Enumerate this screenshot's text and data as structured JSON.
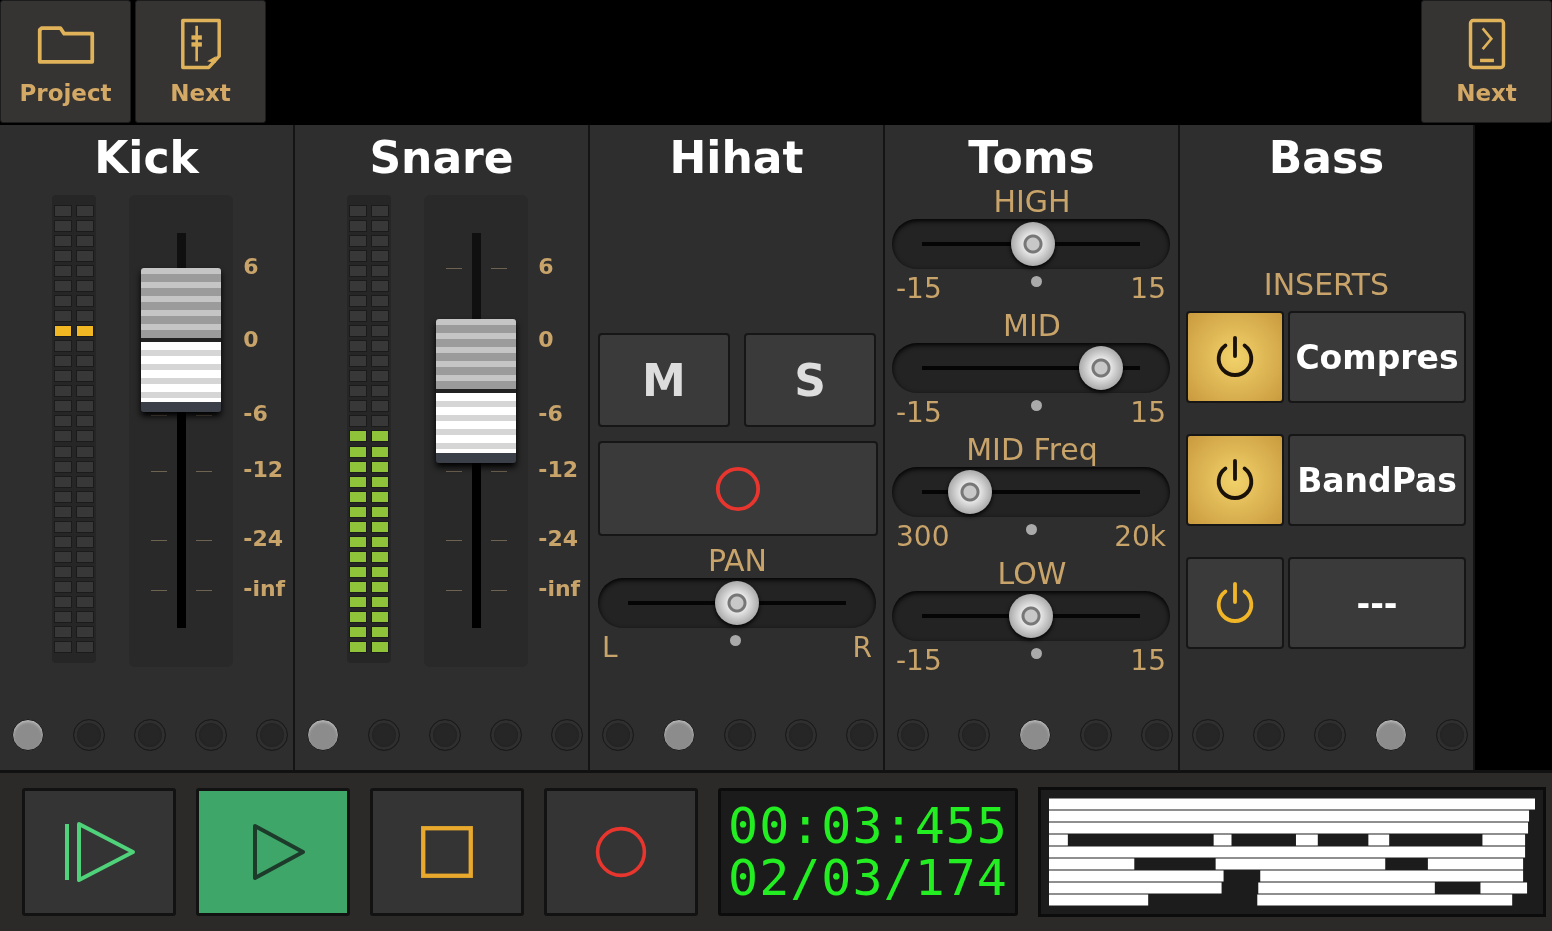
{
  "toolbar": {
    "left": [
      {
        "label": "Project",
        "kind": "folder"
      },
      {
        "label": "Next",
        "kind": "document"
      }
    ],
    "right": [
      {
        "label": "Next",
        "kind": "tablet"
      }
    ]
  },
  "channels": [
    {
      "name": "Kick",
      "kind": "fader",
      "meter": {
        "level": 0
      },
      "peak": {
        "level": 0.7
      },
      "fader": {
        "level": 0.73
      },
      "scale": [
        "6",
        "0",
        "-6",
        "-12",
        "-24",
        "-inf"
      ],
      "dots": [
        {
          "selected": true
        },
        {
          "selected": false
        },
        {
          "selected": false
        },
        {
          "selected": false
        },
        {
          "selected": false
        }
      ]
    },
    {
      "name": "Snare",
      "kind": "fader",
      "meter": {
        "level": 0.5
      },
      "fader": {
        "level": 0.6
      },
      "scale": [
        "6",
        "0",
        "-6",
        "-12",
        "-24",
        "-inf"
      ],
      "dots": [
        {
          "selected": true
        },
        {
          "selected": false
        },
        {
          "selected": false
        },
        {
          "selected": false
        },
        {
          "selected": false
        }
      ]
    },
    {
      "name": "Hihat",
      "kind": "controls",
      "mute": {
        "label": "M",
        "on": false
      },
      "solo": {
        "label": "S",
        "on": false
      },
      "record": {
        "armed": false
      },
      "pan": {
        "label": "PAN",
        "level": 0.5,
        "min": "L",
        "max": "R"
      },
      "dots": [
        {
          "selected": false
        },
        {
          "selected": true
        },
        {
          "selected": false
        },
        {
          "selected": false
        },
        {
          "selected": false
        }
      ]
    },
    {
      "name": "Toms",
      "kind": "eq",
      "bands": [
        {
          "label": "HIGH",
          "level": 0.51,
          "min": "-15",
          "max": "15"
        },
        {
          "label": "MID",
          "level": 0.82,
          "min": "-15",
          "max": "15"
        },
        {
          "label": "MID Freq",
          "level": 0.22,
          "min": "300",
          "max": "20k"
        },
        {
          "label": "LOW",
          "level": 0.5,
          "min": "-15",
          "max": "15"
        }
      ],
      "dots": [
        {
          "selected": false
        },
        {
          "selected": false
        },
        {
          "selected": true
        },
        {
          "selected": false
        },
        {
          "selected": false
        }
      ]
    },
    {
      "name": "Bass",
      "kind": "inserts",
      "heading": "INSERTS",
      "inserts": [
        {
          "name": "Compres",
          "on": true
        },
        {
          "name": "BandPas",
          "on": true
        },
        {
          "name": "---",
          "on": false
        }
      ],
      "dots": [
        {
          "selected": false
        },
        {
          "selected": false
        },
        {
          "selected": false
        },
        {
          "selected": true
        },
        {
          "selected": false
        }
      ]
    }
  ],
  "transport": {
    "buttons": [
      {
        "kind": "play-from-start",
        "selected": false
      },
      {
        "kind": "play",
        "selected": true
      },
      {
        "kind": "stop",
        "selected": false
      },
      {
        "kind": "record",
        "selected": false
      }
    ],
    "time": "00:03:455",
    "position": "02/03/174"
  }
}
